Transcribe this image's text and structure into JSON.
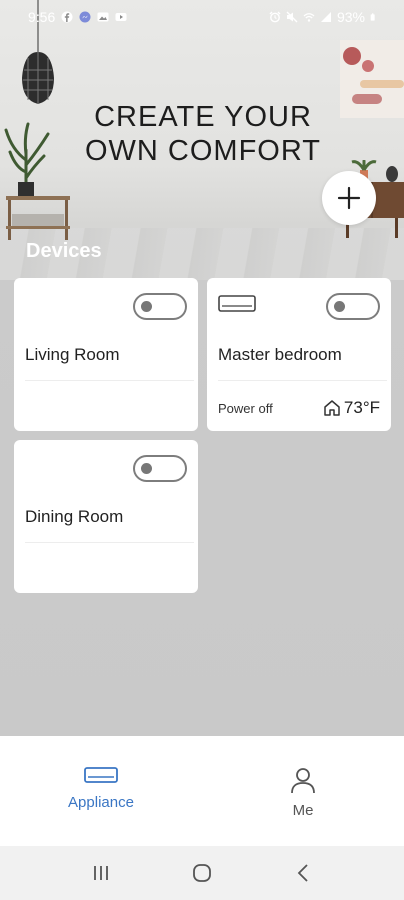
{
  "status_bar": {
    "time": "9:56",
    "battery": "93%",
    "icons_left": [
      "facebook-icon",
      "messenger-icon",
      "gallery-icon",
      "youtube-icon"
    ],
    "icons_right": [
      "alarm-icon",
      "mute-icon",
      "wifi-icon",
      "signal-icon",
      "battery-icon"
    ]
  },
  "hero": {
    "title_line1": "CREATE YOUR",
    "title_line2": "OWN COMFORT",
    "add_button_icon": "plus-icon"
  },
  "section": {
    "title": "Devices"
  },
  "devices": [
    {
      "name": "Living Room",
      "power_on": false,
      "status": "",
      "temperature": ""
    },
    {
      "name": "Master bedroom",
      "power_on": false,
      "status": "Power off",
      "temperature": "73°F",
      "icon": "air-conditioner-icon"
    },
    {
      "name": "Dining Room",
      "power_on": false,
      "status": "",
      "temperature": ""
    }
  ],
  "bottom_nav": {
    "items": [
      {
        "label": "Appliance",
        "icon": "appliance-icon",
        "active": true
      },
      {
        "label": "Me",
        "icon": "user-icon",
        "active": false
      }
    ]
  },
  "colors": {
    "accent": "#3a76c4",
    "inactive": "#555555",
    "card_bg": "#ffffff"
  }
}
